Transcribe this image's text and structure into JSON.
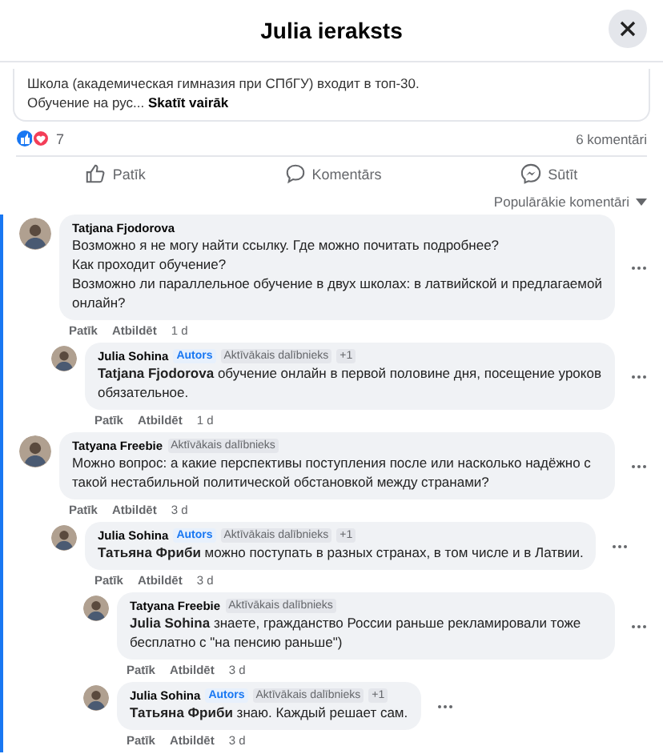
{
  "dialog": {
    "title": "Julia ieraksts"
  },
  "post": {
    "lines": [
      "Школа (академическая гимназия при СПбГУ) входит в топ-30."
    ],
    "truncated_text": "Обучение на рус...",
    "see_more": "Skatīt vairāk"
  },
  "reactions": {
    "count": "7",
    "comments": "6 komentāri"
  },
  "actions": [
    {
      "kind": "like",
      "label": "Patīk"
    },
    {
      "kind": "comment",
      "label": "Komentārs"
    },
    {
      "kind": "send",
      "label": "Sūtīt"
    }
  ],
  "sort": {
    "label": "Populārākie komentāri"
  },
  "comments": [
    {
      "author": "Tatjana Fjodorova",
      "text": [
        "Возможно я не могу найти ссылку. Где можно почитать подробнее?",
        "Как проходит обучение?",
        "Возможно ли параллельное обучение в двух школах: в латвийской и предлагаемой онлайн?"
      ],
      "like": "Patīk",
      "reply": "Atbildēt",
      "time": "1 d",
      "children": [
        {
          "author": "Julia Sohina",
          "badges": [
            {
              "kind": "author",
              "label": "Autors"
            },
            {
              "kind": "fan",
              "label": "Aktīvākais dalībnieks"
            },
            {
              "kind": "more",
              "label": "+1"
            }
          ],
          "text": [
            "**Tatjana Fjodorova** обучение онлайн в первой половине дня, посещение уроков обязательное."
          ],
          "like": "Patīk",
          "reply": "Atbildēt",
          "time": "1 d"
        }
      ]
    },
    {
      "author": "Tatyana Freebie",
      "badges": [
        {
          "kind": "fan",
          "label": "Aktīvākais dalībnieks"
        }
      ],
      "text": [
        "Можно вопрос: а какие перспективы поступления после или насколько надёжно с такой нестабильной политической обстановкой между странами?"
      ],
      "like": "Patīk",
      "reply": "Atbildēt",
      "time": "3 d",
      "children": [
        {
          "author": "Julia Sohina",
          "badges": [
            {
              "kind": "author",
              "label": "Autors"
            },
            {
              "kind": "fan",
              "label": "Aktīvākais dalībnieks"
            },
            {
              "kind": "more",
              "label": "+1"
            }
          ],
          "text": [
            "**Татьяна Фриби** можно поступать в разных странах, в том числе и в Латвии."
          ],
          "like": "Patīk",
          "reply": "Atbildēt",
          "time": "3 d",
          "children": [
            {
              "author": "Tatyana Freebie",
              "badges": [
                {
                  "kind": "fan",
                  "label": "Aktīvākais dalībnieks"
                }
              ],
              "text": [
                "**Julia Sohina** знаете, гражданство России раньше рекламировали тоже бесплатно с \"на пенсию раньше\")"
              ],
              "like": "Patīk",
              "reply": "Atbildēt",
              "time": "3 d"
            },
            {
              "author": "Julia Sohina",
              "badges": [
                {
                  "kind": "author",
                  "label": "Autors"
                },
                {
                  "kind": "fan",
                  "label": "Aktīvākais dalībnieks"
                },
                {
                  "kind": "more",
                  "label": "+1"
                }
              ],
              "text": [
                "**Татьяна Фриби** знаю. Каждый решает сам."
              ],
              "like": "Patīk",
              "reply": "Atbildēt",
              "time": "3 d"
            }
          ]
        }
      ]
    }
  ]
}
